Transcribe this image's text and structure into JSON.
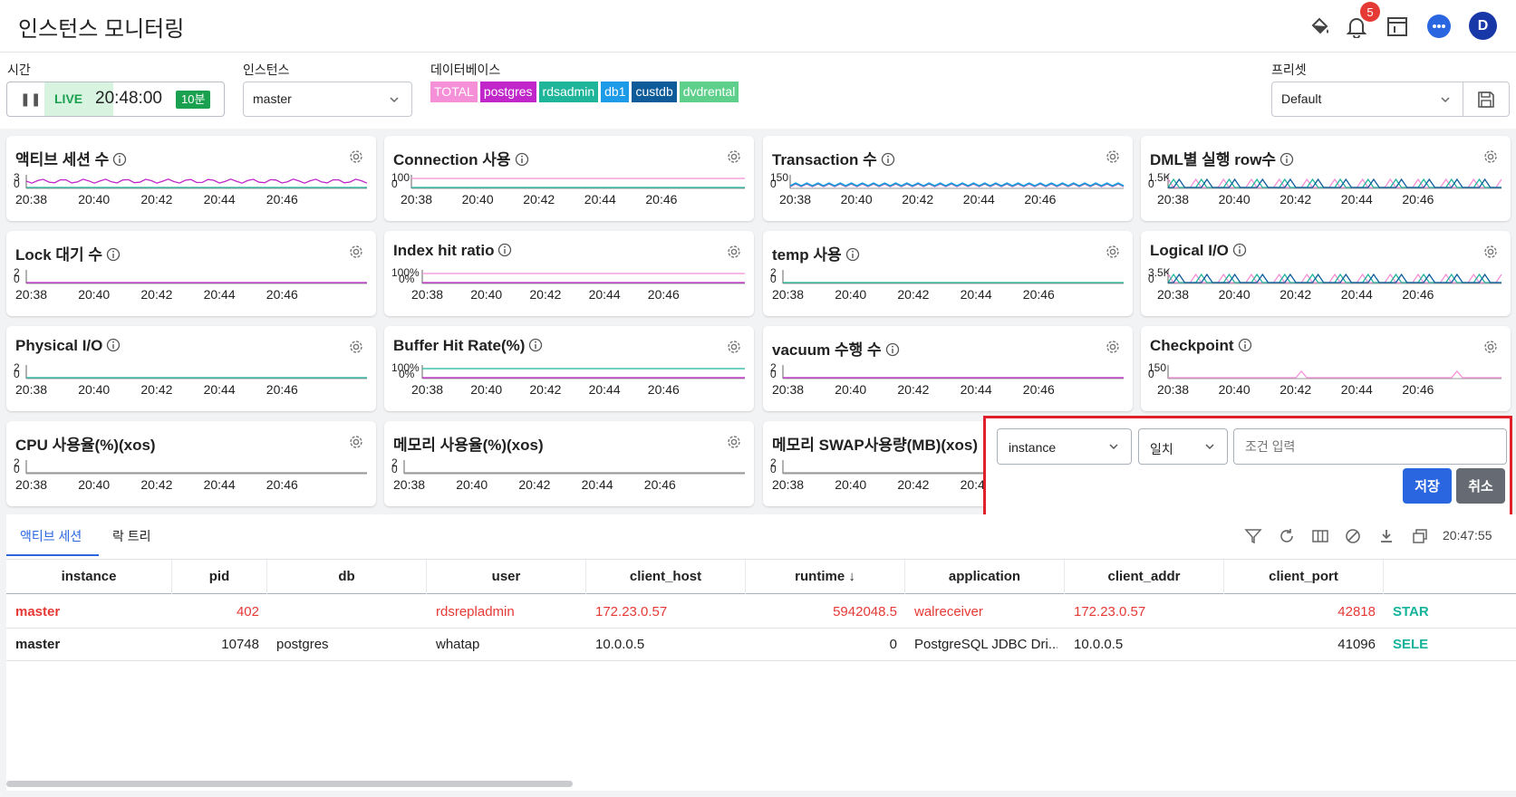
{
  "header": {
    "title": "인스턴스 모니터링",
    "notification_count": "5",
    "avatar_initial": "D"
  },
  "toolbar": {
    "time_label": "시간",
    "live_label": "LIVE",
    "clock": "20:48:00",
    "range": "10분",
    "instance_label": "인스턴스",
    "instance_value": "master",
    "database_label": "데이터베이스",
    "databases": [
      {
        "name": "TOTAL",
        "color": "#f58fd8"
      },
      {
        "name": "postgres",
        "color": "#c026c9"
      },
      {
        "name": "rdsadmin",
        "color": "#1fb59a"
      },
      {
        "name": "db1",
        "color": "#1e9be8"
      },
      {
        "name": "custdb",
        "color": "#0e5b9a"
      },
      {
        "name": "dvdrental",
        "color": "#5fd08c"
      }
    ],
    "preset_label": "프리셋",
    "preset_value": "Default"
  },
  "cards": [
    {
      "title": "액티브 세션 수",
      "ymax": "3",
      "ymin": "0",
      "info": true,
      "series": [
        "#c026c9",
        "#1fb59a"
      ],
      "pattern": "wavy"
    },
    {
      "title": "Connection 사용",
      "ymax": "100",
      "ymin": "0",
      "info": true,
      "series": [
        "#f58fd8",
        "#1fb59a"
      ],
      "pattern": "flat-high"
    },
    {
      "title": "Transaction 수",
      "ymax": "150",
      "ymin": "0",
      "info": true,
      "series": [
        "#c026c9",
        "#1fb59a",
        "#1e9be8"
      ],
      "pattern": "dense-low"
    },
    {
      "title": "DML별 실행 row수",
      "ymax": "1.5K",
      "ymin": "0",
      "info": true,
      "series": [
        "#f58fd8",
        "#1fb59a",
        "#0e5b9a"
      ],
      "pattern": "spiky"
    },
    {
      "title": "Lock 대기 수",
      "ymax": "2",
      "ymin": "0",
      "info": true,
      "series": [
        "#c026c9"
      ],
      "pattern": "flat-mid"
    },
    {
      "title": "Index hit ratio",
      "ymax": "100%",
      "ymin": "0%",
      "info": true,
      "series": [
        "#f58fd8",
        "#c026c9"
      ],
      "pattern": "flat-high"
    },
    {
      "title": "temp 사용",
      "ymax": "2",
      "ymin": "0",
      "info": true,
      "series": [
        "#1fb59a"
      ],
      "pattern": "flat-mid"
    },
    {
      "title": "Logical I/O",
      "ymax": "3.5K",
      "ymin": "0",
      "info": true,
      "series": [
        "#f58fd8",
        "#1fb59a",
        "#0e5b9a"
      ],
      "pattern": "spiky"
    },
    {
      "title": "Physical I/O",
      "ymax": "2",
      "ymin": "0",
      "info": true,
      "series": [
        "#1fb59a"
      ],
      "pattern": "flat-mid"
    },
    {
      "title": "Buffer Hit Rate(%)",
      "ymax": "100%",
      "ymin": "0%",
      "info": true,
      "series": [
        "#1fb59a",
        "#c026c9"
      ],
      "pattern": "flat-high"
    },
    {
      "title": "vacuum 수행 수",
      "ymax": "2",
      "ymin": "0",
      "info": true,
      "series": [
        "#c026c9"
      ],
      "pattern": "flat-mid"
    },
    {
      "title": "Checkpoint",
      "ymax": "150",
      "ymin": "0",
      "info": true,
      "series": [
        "#f58fd8"
      ],
      "pattern": "two-spikes"
    },
    {
      "title": "CPU 사용율(%)(xos)",
      "ymax": "2",
      "ymin": "0",
      "info": false,
      "series": [
        "#999999"
      ],
      "pattern": "flat-mid"
    },
    {
      "title": "메모리 사용율(%)(xos)",
      "ymax": "2",
      "ymin": "0",
      "info": false,
      "series": [
        "#999999"
      ],
      "pattern": "flat-mid"
    },
    {
      "title": "메모리 SWAP사용량(MB)(xos)",
      "ymax": "2",
      "ymin": "0",
      "info": false,
      "series": [
        "#999999"
      ],
      "pattern": "flat-mid"
    }
  ],
  "time_ticks": [
    "20:38",
    "20:40",
    "20:42",
    "20:44",
    "20:46"
  ],
  "filter": {
    "field": "instance",
    "operator": "일치",
    "placeholder": "조건 입력",
    "save": "저장",
    "cancel": "취소"
  },
  "table": {
    "tabs": [
      "액티브 세션",
      "락 트리"
    ],
    "timestamp": "20:47:55",
    "columns": [
      "instance",
      "pid",
      "db",
      "user",
      "client_host",
      "runtime ↓",
      "application",
      "client_addr",
      "client_port"
    ],
    "rows": [
      {
        "instance": "master",
        "pid": "402",
        "db": "",
        "user": "rdsrepladmin",
        "client_host": "172.23.0.57",
        "runtime": "5942048.5",
        "application": "walreceiver",
        "client_addr": "172.23.0.57",
        "client_port": "42818",
        "state": "STAR",
        "highlight": true
      },
      {
        "instance": "master",
        "pid": "10748",
        "db": "postgres",
        "user": "whatap",
        "client_host": "10.0.0.5",
        "runtime": "0",
        "application": "PostgreSQL JDBC Dri...",
        "client_addr": "10.0.0.5",
        "client_port": "41096",
        "state": "SELE",
        "highlight": false
      }
    ]
  }
}
